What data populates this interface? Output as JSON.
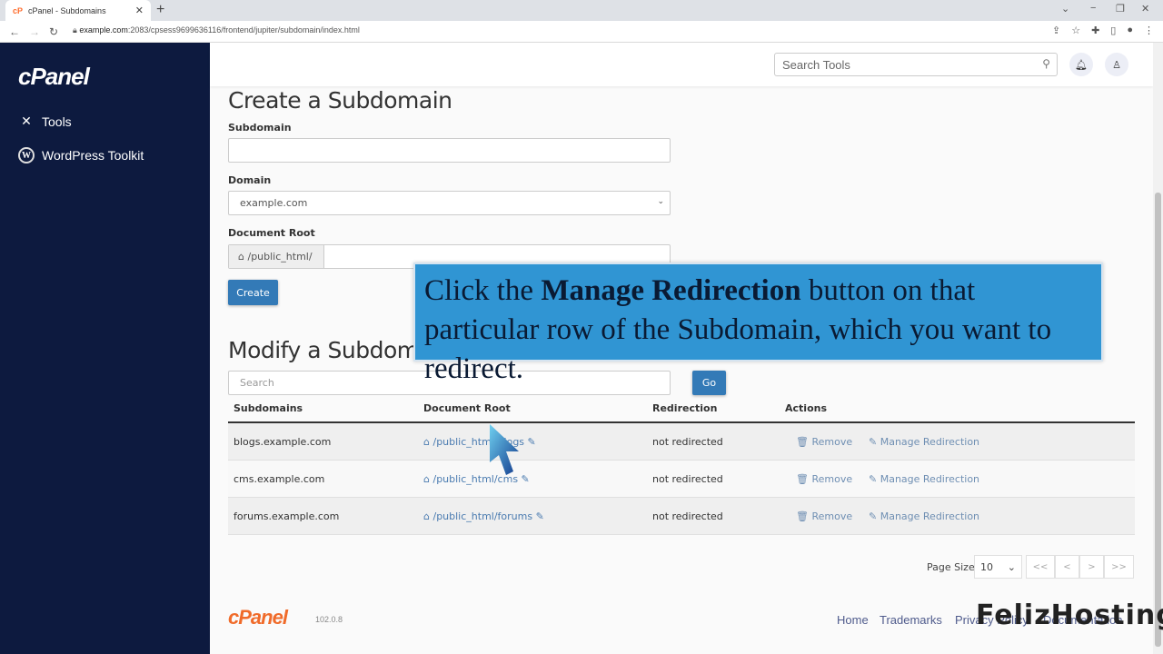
{
  "browser": {
    "tab_title": "cPanel - Subdomains",
    "tab_favicon": "cP",
    "url_host": "example.com",
    "url_rest": ":2083/cpsess9699636116/frontend/jupiter/subdomain/index.html"
  },
  "sidebar": {
    "logo": "cPanel",
    "items": [
      {
        "label": "Tools",
        "icon": "tools-icon"
      },
      {
        "label": "WordPress Toolkit",
        "icon": "wordpress-icon"
      }
    ]
  },
  "topbar": {
    "search_placeholder": "Search Tools"
  },
  "create": {
    "title": "Create a Subdomain",
    "subdomain_label": "Subdomain",
    "subdomain_value": "",
    "domain_label": "Domain",
    "domain_selected": "example.com",
    "docroot_label": "Document Root",
    "docroot_prefix": "/public_html/",
    "docroot_value": "",
    "create_button": "Create"
  },
  "modify": {
    "title": "Modify a Subdomain",
    "search_placeholder": "Search",
    "go_button": "Go",
    "columns": [
      "Subdomains",
      "Document Root",
      "Redirection",
      "Actions"
    ],
    "rows": [
      {
        "subdomain": "blogs.example.com",
        "docroot": "/public_html/blogs",
        "redirection": "not redirected",
        "remove": "Remove",
        "manage": "Manage Redirection"
      },
      {
        "subdomain": "cms.example.com",
        "docroot": "/public_html/cms",
        "redirection": "not redirected",
        "remove": "Remove",
        "manage": "Manage Redirection"
      },
      {
        "subdomain": "forums.example.com",
        "docroot": "/public_html/forums",
        "redirection": "not redirected",
        "remove": "Remove",
        "manage": "Manage Redirection"
      }
    ],
    "page_size_label": "Page Size",
    "page_size_value": "10",
    "pager": [
      "<<",
      "<",
      ">",
      ">>"
    ]
  },
  "footer": {
    "logo": "cPanel",
    "version": "102.0.8",
    "links": [
      "Home",
      "Trademarks",
      "Privacy Policy",
      "Documentation"
    ]
  },
  "callout": {
    "pre": "Click the ",
    "bold": "Manage Redirection",
    "post": " button on that particular row of the Subdomain, which you want to redirect."
  },
  "watermark": "FelizHosting",
  "colors": {
    "sidebar_bg": "#0d1a3f",
    "primary": "#337ab7",
    "brand_orange": "#f06b2a",
    "callout_bg": "#3095d3"
  }
}
